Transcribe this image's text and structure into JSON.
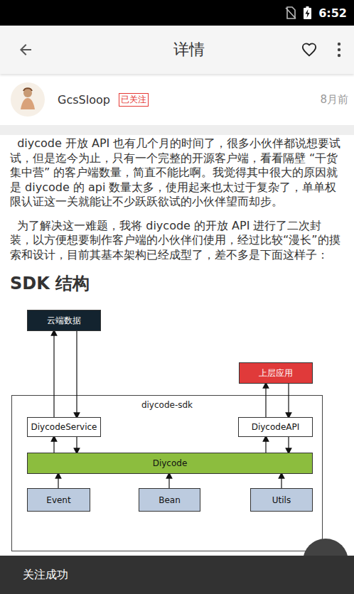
{
  "status_bar": {
    "time": "6:52"
  },
  "app_bar": {
    "title": "详情",
    "favorited": false
  },
  "author": {
    "name": "GcsSloop",
    "badge": "已关注",
    "time": "8月前"
  },
  "article": {
    "paragraphs": [
      "  diycode 开放 API 也有几个月的时间了，很多小伙伴都说想要试试，但是迄今为止，只有一个完整的开源客户端，看看隔壁 “干货集中营” 的客户端数量，简直不能比啊。我觉得其中很大的原因就是 diycode 的 api 数量太多，使用起来也太过于复杂了，单单权限认证这一关就能让不少跃跃欲试的小伙伴望而却步。",
      "  为了解决这一难题，我将 diycode 的开放 API 进行了二次封装，以方便想要制作客户端的小伙伴们使用，经过比较“漫长”的摸索和设计，目前其基本架构已经成型了，差不多是下面这样子："
    ],
    "heading": "SDK 结构"
  },
  "diagram": {
    "caption": "diycode-sdk",
    "nodes": [
      {
        "label": "云端数据",
        "color": "#13232f"
      },
      {
        "label": "上层应用",
        "color": "#e03a3a"
      },
      {
        "label": "DiycodeService",
        "color": "#ffffff"
      },
      {
        "label": "DiycodeAPI",
        "color": "#ffffff"
      },
      {
        "label": "Diycode",
        "color": "#8cbd3e"
      },
      {
        "label": "Event",
        "color": "#bccbdf"
      },
      {
        "label": "Bean",
        "color": "#bccbdf"
      },
      {
        "label": "Utils",
        "color": "#bccbdf"
      }
    ]
  },
  "snackbar": {
    "message": "关注成功"
  }
}
